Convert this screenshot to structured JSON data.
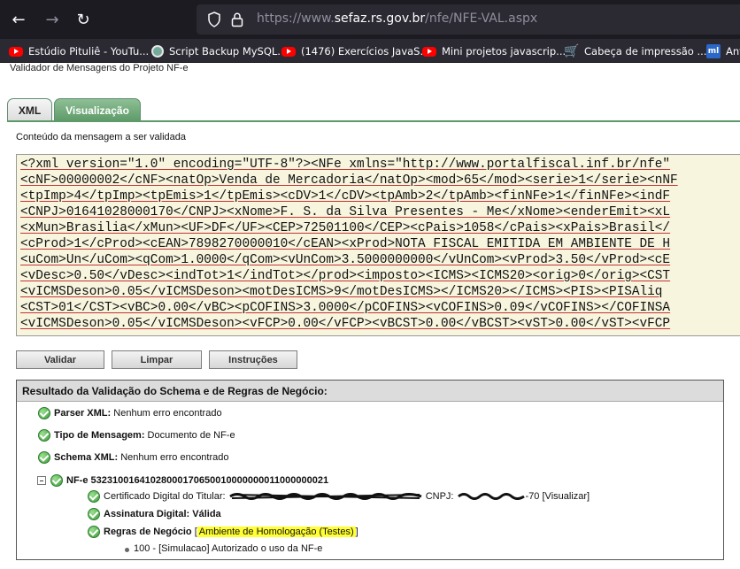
{
  "browser": {
    "url_prefix": "https://www.",
    "url_host": "sefaz.rs.gov.br",
    "url_path": "/nfe/NFE-VAL.aspx",
    "bookmarks": [
      {
        "label": "Estúdio Pituliê - YouTu...",
        "icon": "youtube-icon"
      },
      {
        "label": "Script Backup MySQL.",
        "icon": "chatgpt-icon"
      },
      {
        "label": "(1476) Exercícios JavaS...",
        "icon": "youtube-icon"
      },
      {
        "label": "Mini projetos javascrip...",
        "icon": "youtube-icon"
      },
      {
        "label": "Cabeça de impressão ...",
        "icon": "cart-icon"
      },
      {
        "label": "Ant",
        "icon": "mercadolivre-icon"
      }
    ]
  },
  "page": {
    "title": "Validador de Mensagens do Projeto NF-e",
    "tabs": [
      {
        "label": "XML",
        "active": false
      },
      {
        "label": "Visualização",
        "active": true
      }
    ],
    "content_label": "Conteúdo da mensagem a ser validada",
    "xml_lines": [
      "<?xml version=\"1.0\" encoding=\"UTF-8\"?><NFe xmlns=\"http://www.portalfiscal.inf.br/nfe\"",
      "<cNF>00000002</cNF><natOp>Venda de Mercadoria</natOp><mod>65</mod><serie>1</serie><nNF",
      "<tpImp>4</tpImp><tpEmis>1</tpEmis><cDV>1</cDV><tpAmb>2</tpAmb><finNFe>1</finNFe><indF",
      "<CNPJ>01641028000170</CNPJ><xNome>F. S. da Silva Presentes - Me</xNome><enderEmit><xL",
      "<xMun>Brasilia</xMun><UF>DF</UF><CEP>72501100</CEP><cPais>1058</cPais><xPais>Brasil</",
      "<cProd>1</cProd><cEAN>7898270000010</cEAN><xProd>NOTA FISCAL EMITIDA EM AMBIENTE DE H",
      "<uCom>Un</uCom><qCom>1.0000</qCom><vUnCom>3.5000000000</vUnCom><vProd>3.50</vProd><cE",
      "<vDesc>0.50</vDesc><indTot>1</indTot></prod><imposto><ICMS><ICMS20><orig>0</orig><CST",
      "<vICMSDeson>0.05</vICMSDeson><motDesICMS>9</motDesICMS></ICMS20></ICMS><PIS><PISAliq",
      "<CST>01</CST><vBC>0.00</vBC><pCOFINS>3.0000</pCOFINS><vCOFINS>0.09</vCOFINS></COFINSA",
      "<vICMSDeson>0.05</vICMSDeson><vFCP>0.00</vFCP><vBCST>0.00</vBCST><vST>0.00</vST><vFCP"
    ],
    "buttons": {
      "validar": "Validar",
      "limpar": "Limpar",
      "instrucoes": "Instruções"
    },
    "result": {
      "header": "Resultado da Validação do Schema e de Regras de Negócio:",
      "parser_label": "Parser XML:",
      "parser_value": "Nenhum erro encontrado",
      "tipo_label": "Tipo de Mensagem:",
      "tipo_value": "Documento de NF-e",
      "schema_label": "Schema XML:",
      "schema_value": "Nenhum erro encontrado",
      "nfe_label": "NF-e 53231001641028000170650010000000011000000021",
      "cert_label": "Certificado Digital do Titular:",
      "cert_cnpj_prefix": "CNPJ:",
      "cert_cnpj_suffix": "-70",
      "cert_link": "[Visualizar]",
      "assinatura_label": "Assinatura Digital:",
      "assinatura_value": "Válida",
      "regras_label": "Regras de Negócio",
      "regras_open": "[",
      "regras_value": "Ambiente de Homologação (Testes)",
      "regras_close": "]",
      "autorizado": "100 - [Simulacao] Autorizado o uso da NF-e"
    }
  },
  "colors": {
    "browser_bg": "#1c1b22",
    "tab_active": "#5e9a69",
    "xml_bg": "#f7f5dd",
    "highlight": "#ffff33",
    "check_green": "#3a9a3a"
  }
}
